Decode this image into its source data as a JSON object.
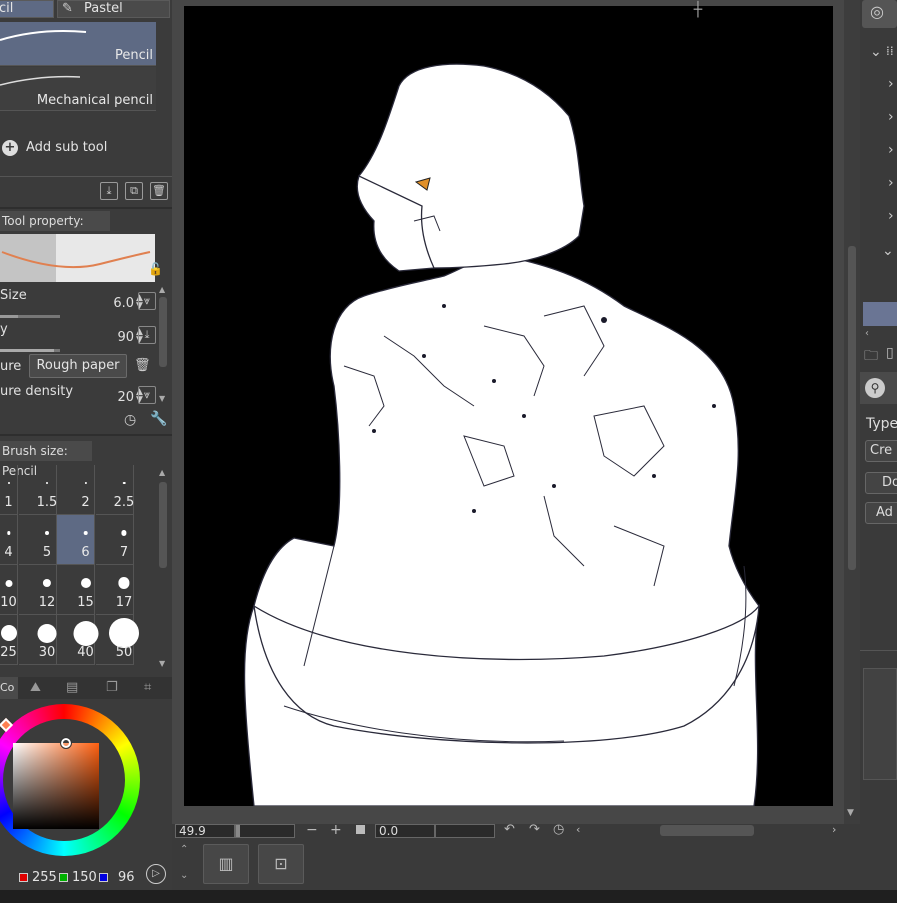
{
  "subtool_tabs": [
    "cil",
    "Pastel"
  ],
  "brushes": [
    "Pencil",
    "Mechanical pencil"
  ],
  "add_sub_tool": "Add sub tool",
  "tool_property": {
    "header": "Tool property: Pencil",
    "size_label": "Size",
    "size_value": "6.0",
    "opacity_label": "y",
    "opacity_value": "90",
    "texture_label": "ure",
    "texture_value": "Rough paper",
    "texture_density_label": "ure density",
    "texture_density_value": "20"
  },
  "brush_size": {
    "header": "Brush size: Pencil",
    "sizes": [
      "1",
      "1.5",
      "2",
      "2.5",
      "4",
      "5",
      "6",
      "7",
      "10",
      "12",
      "15",
      "17",
      "25",
      "30",
      "40",
      "50"
    ],
    "selected": "6"
  },
  "color_panel": {
    "tab_label": "Co",
    "r": "255",
    "g": "150",
    "b": "96",
    "red_color": "#e00000",
    "green_color": "#00b000",
    "blue_color": "#0000e0",
    "selected_color": "#ff9660"
  },
  "navigator": {
    "zoom": "49.9",
    "rotation": "0.0"
  },
  "right_panel": {
    "type_label": "Type",
    "buttons": [
      "Cre",
      "Do",
      "Ad"
    ]
  },
  "icons": [
    "pencil-icon",
    "add-icon",
    "import-icon",
    "copy-icon",
    "trash-icon",
    "lock-icon",
    "wrench-icon",
    "reset-icon",
    "search-icon",
    "zoom-out-icon",
    "zoom-in-icon",
    "undo-icon",
    "redo-icon",
    "reset-rotation-icon"
  ]
}
